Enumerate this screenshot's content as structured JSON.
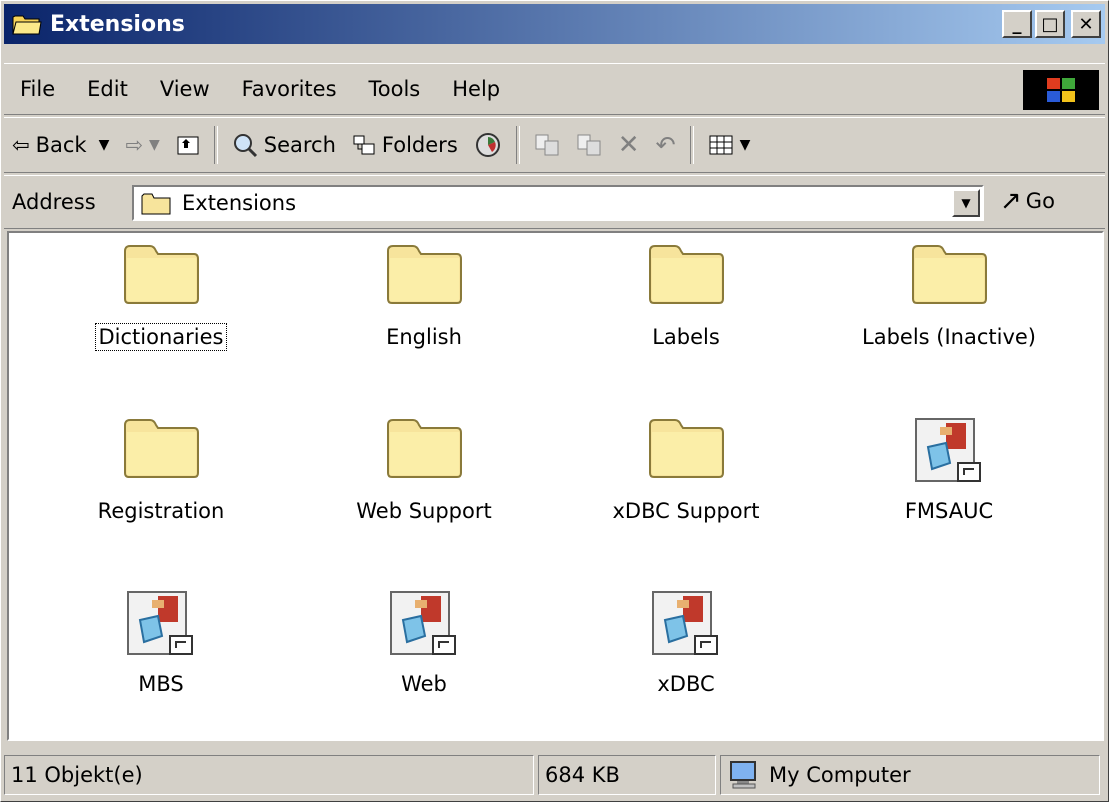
{
  "window": {
    "title": "Extensions",
    "controls": [
      "_",
      "□",
      "✕"
    ]
  },
  "menu": [
    "File",
    "Edit",
    "View",
    "Favorites",
    "Tools",
    "Help"
  ],
  "toolbar": {
    "back_label": "Back",
    "search_label": "Search",
    "folders_label": "Folders"
  },
  "address": {
    "label": "Address",
    "value": "Extensions",
    "go_label": "Go"
  },
  "items": [
    {
      "name": "Dictionaries",
      "type": "folder",
      "focused": true
    },
    {
      "name": "English",
      "type": "folder"
    },
    {
      "name": "Labels",
      "type": "folder"
    },
    {
      "name": "Labels (Inactive)",
      "type": "folder"
    },
    {
      "name": "Registration",
      "type": "folder"
    },
    {
      "name": "Web Support",
      "type": "folder"
    },
    {
      "name": "xDBC Support",
      "type": "folder"
    },
    {
      "name": "FMSAUC",
      "type": "plugin"
    },
    {
      "name": "MBS",
      "type": "plugin"
    },
    {
      "name": "Web",
      "type": "plugin"
    },
    {
      "name": "xDBC",
      "type": "plugin"
    }
  ],
  "status": {
    "objects": "11 Objekt(e)",
    "size": "684 KB",
    "location": "My Computer"
  },
  "colors": {
    "titlebar_start": "#0a246a",
    "titlebar_end": "#a6caf0",
    "folder": "#f7e49c"
  }
}
